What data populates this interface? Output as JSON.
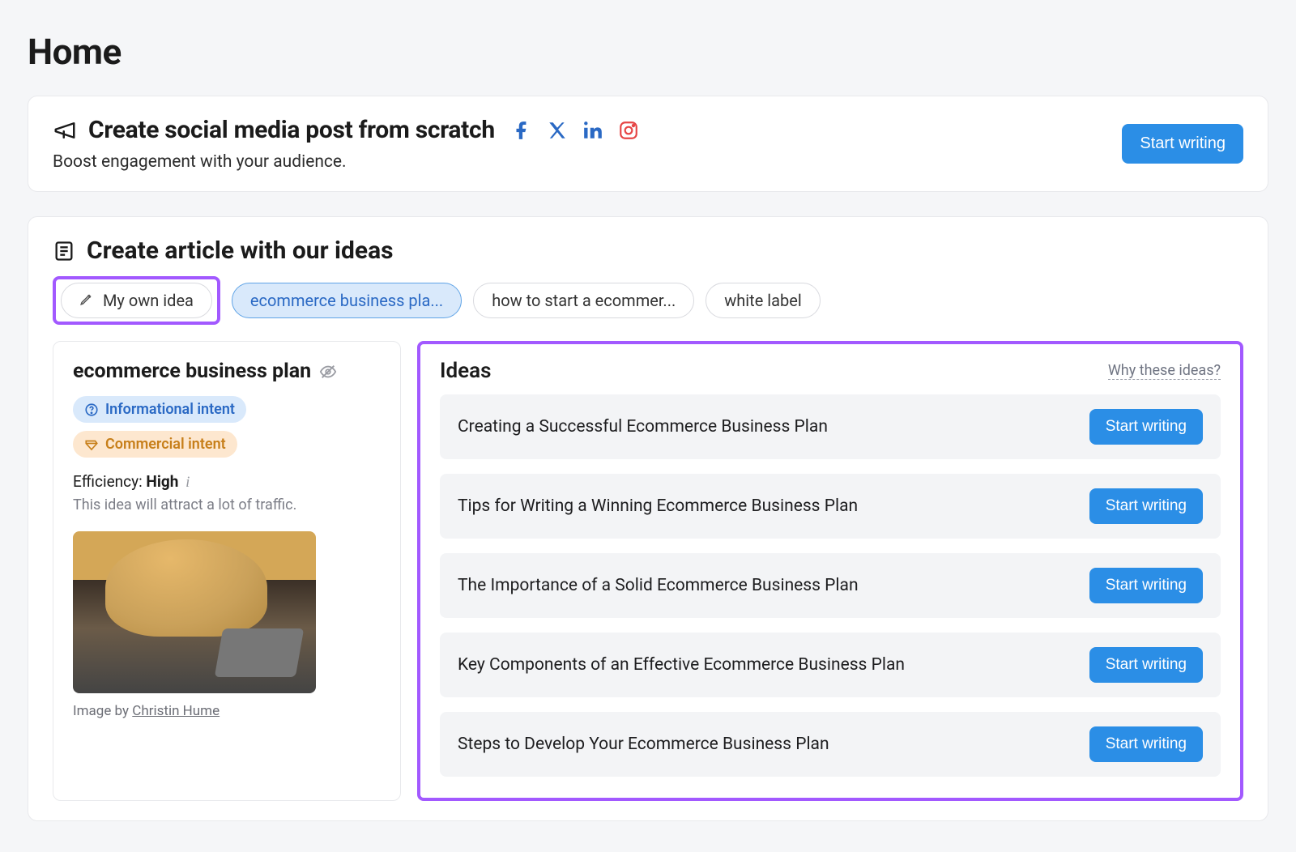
{
  "page": {
    "title": "Home"
  },
  "social_card": {
    "title": "Create social media post from scratch",
    "subtitle": "Boost engagement with your audience.",
    "cta": "Start writing"
  },
  "article_card": {
    "title": "Create article with our ideas",
    "chips": {
      "own_idea": "My own idea",
      "active": "ecommerce business pla...",
      "c2": "how to start a ecommer...",
      "c3": "white label"
    },
    "keyword": {
      "title": "ecommerce business plan",
      "intent_info": "Informational intent",
      "intent_comm": "Commercial intent",
      "efficiency_label": "Efficiency: ",
      "efficiency_value": "High",
      "efficiency_desc": "This idea will attract a lot of traffic.",
      "image_credit_prefix": "Image by ",
      "image_credit_name": "Christin Hume"
    },
    "ideas": {
      "heading": "Ideas",
      "why_link": "Why these ideas?",
      "cta": "Start writing",
      "items": [
        "Creating a Successful Ecommerce Business Plan",
        "Tips for Writing a Winning Ecommerce Business Plan",
        "The Importance of a Solid Ecommerce Business Plan",
        "Key Components of an Effective Ecommerce Business Plan",
        "Steps to Develop Your Ecommerce Business Plan"
      ]
    }
  }
}
